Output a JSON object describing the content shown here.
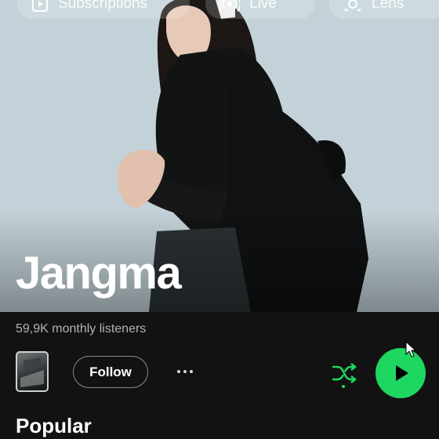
{
  "top_chips": [
    {
      "label": "Subscriptions",
      "icon": "play-square-icon"
    },
    {
      "label": "Live",
      "icon": "broadcast-icon"
    },
    {
      "label": "Lens",
      "icon": "lens-icon"
    }
  ],
  "artist": {
    "name": "Jangma",
    "monthly_listeners": "59,9K monthly listeners"
  },
  "actions": {
    "follow_label": "Follow",
    "more_icon": "more-dots-icon",
    "shuffle_icon": "shuffle-icon",
    "play_icon": "play-icon"
  },
  "section": {
    "title": "Popular"
  },
  "colors": {
    "accent": "#1ed760",
    "background": "#121212",
    "muted_text": "#b3b3b3"
  }
}
